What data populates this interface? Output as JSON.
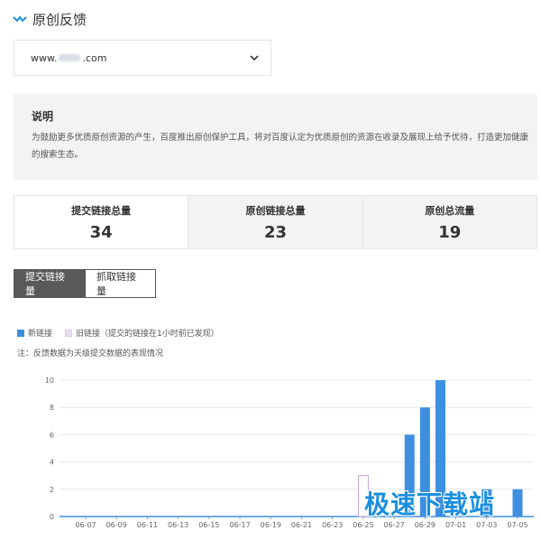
{
  "header": {
    "title": "原创反馈",
    "logo_icon": "wave-logo-icon",
    "accent": "#1a8fe0"
  },
  "site_select": {
    "value_prefix": "www.",
    "value_suffix": ".com",
    "chevron_icon": "chevron-down-icon"
  },
  "description": {
    "heading": "说明",
    "text": "为鼓励更多优质原创资源的产生，百度推出原创保护工具，将对百度认定为优质原创的资源在收录及展现上给予优待，打造更加健康的搜索生态。"
  },
  "stats": [
    {
      "label": "提交链接总量",
      "value": "34"
    },
    {
      "label": "原创链接总量",
      "value": "23"
    },
    {
      "label": "原创总流量",
      "value": "19"
    }
  ],
  "tabs": [
    {
      "label": "提交链接量",
      "active": true
    },
    {
      "label": "抓取链接量",
      "active": false
    }
  ],
  "legend": {
    "new_label": "新链接",
    "old_label": "旧链接（提交的链接在1小时前已发现）",
    "new_color": "#3d8fe0",
    "old_color": "#e8e0f0"
  },
  "note": "注：反馈数据为天级提交数据的表现情况",
  "watermark": "极速下载站",
  "chart_data": {
    "type": "bar",
    "xlabel": "",
    "ylabel": "",
    "ylim": [
      0,
      10
    ],
    "yticks": [
      0,
      2,
      4,
      6,
      8,
      10
    ],
    "grid": true,
    "tick_labels": [
      "06-07",
      "06-09",
      "06-11",
      "06-13",
      "06-15",
      "06-17",
      "06-19",
      "06-21",
      "06-23",
      "06-25",
      "06-27",
      "06-29",
      "07-01",
      "07-03",
      "07-05"
    ],
    "categories": [
      "06-25",
      "06-26",
      "06-27",
      "06-28",
      "06-29",
      "06-30",
      "07-01",
      "07-02",
      "07-03",
      "07-04",
      "07-05"
    ],
    "series": [
      {
        "name": "新链接",
        "values": [
          0,
          0,
          0,
          6,
          8,
          10,
          0,
          0,
          2,
          0,
          2
        ]
      },
      {
        "name": "旧链接（提交的链接在1小时前已发现）",
        "values": [
          3,
          0,
          0,
          0,
          0,
          0,
          0,
          0,
          0,
          0,
          0
        ]
      }
    ]
  }
}
